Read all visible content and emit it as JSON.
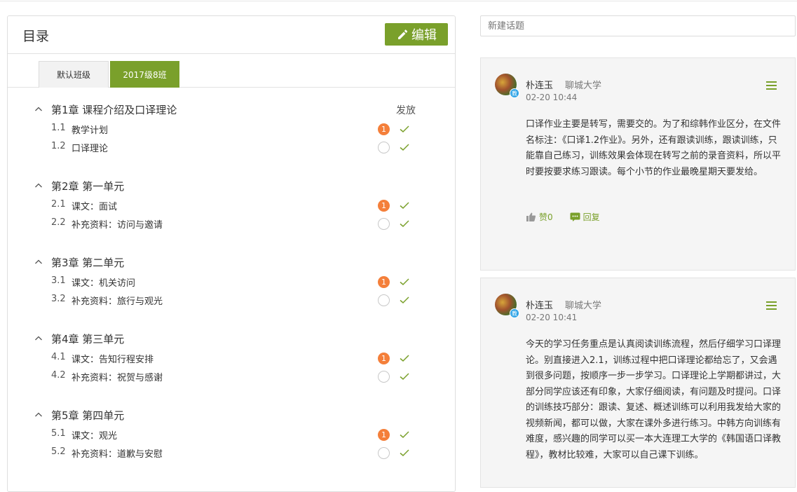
{
  "catalog": {
    "title": "目录",
    "edit_label": "编辑",
    "tabs": [
      {
        "label": "默认班级",
        "active": false
      },
      {
        "label": "2017级8班",
        "active": true
      }
    ],
    "publish_label": "发放",
    "chapters": [
      {
        "title": "第1章 课程介绍及口译理论",
        "sections": [
          {
            "num": "1.1",
            "title": "教学计划",
            "badge": "1",
            "published": true
          },
          {
            "num": "1.2",
            "title": "口译理论",
            "badge": "",
            "published": true
          }
        ]
      },
      {
        "title": "第2章 第一单元",
        "sections": [
          {
            "num": "2.1",
            "title": "课文：面试",
            "badge": "1",
            "published": true
          },
          {
            "num": "2.2",
            "title": "补充资料：访问与邀请",
            "badge": "",
            "published": true
          }
        ]
      },
      {
        "title": "第3章 第二单元",
        "sections": [
          {
            "num": "3.1",
            "title": "课文：机关访问",
            "badge": "1",
            "published": true
          },
          {
            "num": "3.2",
            "title": "补充资料：旅行与观光",
            "badge": "",
            "published": true
          }
        ]
      },
      {
        "title": "第4章 第三单元",
        "sections": [
          {
            "num": "4.1",
            "title": "课文：告知行程安排",
            "badge": "1",
            "published": true
          },
          {
            "num": "4.2",
            "title": "补充资料：祝贺与感谢",
            "badge": "",
            "published": true
          }
        ]
      },
      {
        "title": "第5章 第四单元",
        "sections": [
          {
            "num": "5.1",
            "title": "课文：观光",
            "badge": "1",
            "published": true
          },
          {
            "num": "5.2",
            "title": "补充资料：道歉与安慰",
            "badge": "",
            "published": true
          }
        ]
      }
    ]
  },
  "discussion": {
    "new_topic_placeholder": "新建话题",
    "posts": [
      {
        "author": "朴连玉",
        "school": "聊城大学",
        "avatar_tag": "教",
        "time": "02-20 10:44",
        "body": "口译作业主要是转写，需要交的。为了和综韩作业区分，在文件名标注：《口译1.2作业》。另外，还有跟读训练，跟读训练，只能靠自己练习，训练效果会体现在转写之前的录音资料，所以平时要按要求练习跟读。每个小节的作业最晚星期天要发给。",
        "like_label": "赞0",
        "reply_label": "回复"
      },
      {
        "author": "朴连玉",
        "school": "聊城大学",
        "avatar_tag": "教",
        "time": "02-20 10:41",
        "body": "今天的学习任务重点是认真阅读训练流程，然后仔细学习口译理论。别直接进入2.1，训练过程中把口译理论都给忘了，又会遇到很多问题，按顺序一步一步学习。口译理论上学期都讲过，大部分同学应该还有印象，大家仔细阅读，有问题及时提问。口译的训练技巧部分：跟读、复述、概述训练可以利用我发给大家的视频新闻，都可以做，大家在课外多进行练习。中韩方向训练有难度，感兴趣的同学可以买一本大连理工大学的《韩国语口译教程》，教材比较难，大家可以自己课下训练。"
      }
    ]
  },
  "colors": {
    "accent": "#7aa02b",
    "badge": "#f47f3a",
    "avatar_tag": "#2ea3e6"
  }
}
